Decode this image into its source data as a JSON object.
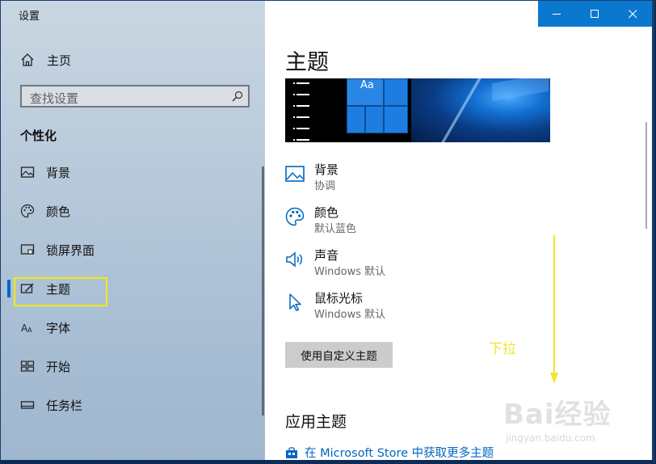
{
  "window": {
    "title": "设置",
    "accent_color": "#0b78d0"
  },
  "sidebar": {
    "home_label": "主页",
    "search_placeholder": "查找设置",
    "section_title": "个性化",
    "items": [
      {
        "label": "背景",
        "icon": "image-icon"
      },
      {
        "label": "颜色",
        "icon": "palette-icon"
      },
      {
        "label": "锁屏界面",
        "icon": "lock-screen-icon"
      },
      {
        "label": "主题",
        "icon": "theme-icon",
        "active": true
      },
      {
        "label": "字体",
        "icon": "font-icon"
      },
      {
        "label": "开始",
        "icon": "start-icon"
      },
      {
        "label": "任务栏",
        "icon": "taskbar-icon"
      }
    ]
  },
  "main": {
    "title": "主题",
    "preview_tile_text": "Aa",
    "settings": [
      {
        "name": "背景",
        "value": "协调",
        "icon": "image-icon"
      },
      {
        "name": "颜色",
        "value": "默认蓝色",
        "icon": "palette-icon"
      },
      {
        "name": "声音",
        "value": "Windows 默认",
        "icon": "speaker-icon"
      },
      {
        "name": "鼠标光标",
        "value": "Windows 默认",
        "icon": "cursor-icon"
      }
    ],
    "custom_theme_button": "使用自定义主题",
    "apply_theme_heading": "应用主题",
    "store_link": "在 Microsoft Store 中获取更多主题"
  },
  "annotation": {
    "text": "下拉",
    "color": "#f1e62c"
  },
  "watermark": {
    "text": "Bai经验",
    "url_text": "jingyan.baidu.com"
  }
}
